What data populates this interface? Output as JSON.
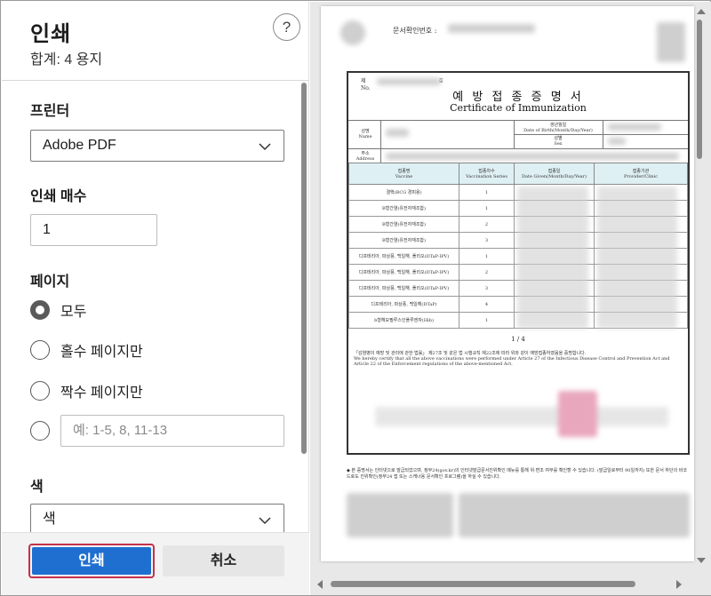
{
  "dialog": {
    "title": "인쇄",
    "subtitle": "합계: 4 용지",
    "help_symbol": "?"
  },
  "printer": {
    "label": "프린터",
    "selected": "Adobe PDF"
  },
  "copies": {
    "label": "인쇄 매수",
    "value": "1"
  },
  "pages": {
    "label": "페이지",
    "options": [
      {
        "label": "모두",
        "checked": true
      },
      {
        "label": "홀수 페이지만",
        "checked": false
      },
      {
        "label": "짝수 페이지만",
        "checked": false
      }
    ],
    "custom_placeholder": "예: 1-5, 8, 11-13"
  },
  "color": {
    "label": "색",
    "selected": "색"
  },
  "footer": {
    "print_label": "인쇄",
    "cancel_label": "취소"
  },
  "preview": {
    "doc_number_label": "문서확인번호 :",
    "cert_no_prefix": "제",
    "cert_no_suffix": "호",
    "cert_no_en": "No.",
    "title_ko": "예 방 접 종 증 명 서",
    "title_en": "Certificate of Immunization",
    "name_ko": "성명",
    "name_en": "Name",
    "birth_ko": "생년월일",
    "birth_en": "Date of Birth(Month/Day/Year)",
    "sex_ko": "성별",
    "sex_en": "Sex",
    "address_ko": "주소",
    "address_en": "Address",
    "table_headers": [
      {
        "ko": "접종명",
        "en": "Vaccine"
      },
      {
        "ko": "접종차수",
        "en": "Vaccination Series"
      },
      {
        "ko": "접종일",
        "en": "Date Given(Month/Day/Year)"
      },
      {
        "ko": "접종기관",
        "en": "Provider/Clinic"
      }
    ],
    "rows": [
      {
        "vaccine": "결핵(BCG 경피용)",
        "series": "1"
      },
      {
        "vaccine": "B형간염(유전자재조합)",
        "series": "1"
      },
      {
        "vaccine": "B형간염(유전자재조합)",
        "series": "2"
      },
      {
        "vaccine": "B형간염(유전자재조합)",
        "series": "3"
      },
      {
        "vaccine": "디프테리아, 파상풍, 백일해, 폴리오(DTaP-IPV)",
        "series": "1"
      },
      {
        "vaccine": "디프테리아, 파상풍, 백일해, 폴리오(DTaP-IPV)",
        "series": "2"
      },
      {
        "vaccine": "디프테리아, 파상풍, 백일해, 폴리오(DTaP-IPV)",
        "series": "3"
      },
      {
        "vaccine": "디프테리아, 파상풍, 백일해(DTaP)",
        "series": "4"
      },
      {
        "vaccine": "b형헤모필루스인플루엔자(Hib)",
        "series": "1"
      }
    ],
    "page_indicator": "1 / 4",
    "cert_statement_ko": "「감염병의 예방 및 관리에 관한 법률」 제27조 및 같은 법 시행규칙 제22조에 따라 위와 같이 예방접종하였음을 증명합니다.",
    "cert_statement_en": "We hereby certify that all the above vaccinations were performed under Article 27 of the Infectious Disease Control and Prevention Act and Article 22 of the Enforcement regulations of the above-mentioned Act.",
    "bottom_note": "◆ 본 증명서는 인터넷으로 발급되었으며, 정부24(gov.kr)의 인터넷발급문서진위확인 메뉴를 통해 위·변조 여부를 확인할 수 있습니다. (발급일로부터 90일까지) 또한 문서 하단의 바코드로도 진위확인(정부24 앱 또는 스캐너용 문서확인 프로그램)을 하실 수 있습니다."
  }
}
